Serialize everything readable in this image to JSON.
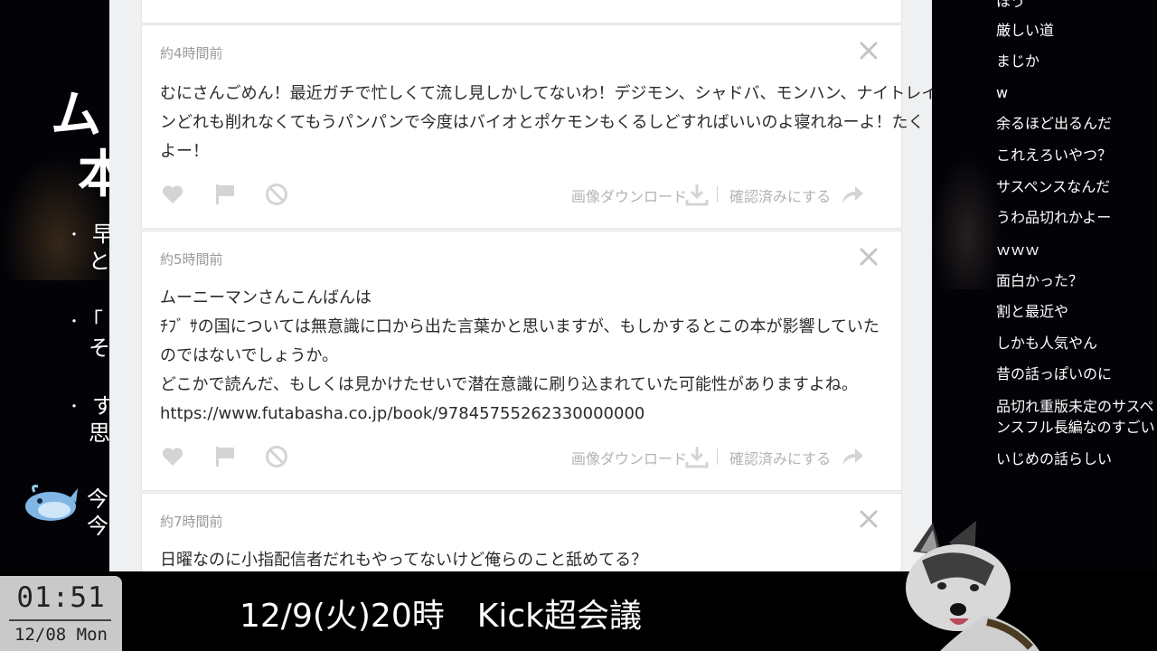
{
  "background": {
    "title_line1": "ム",
    "title_line2": "本",
    "bullets": [
      {
        "marker": "・",
        "line1": "早",
        "line2": "と"
      },
      {
        "marker": "・",
        "line1": "「",
        "line2": "そ"
      },
      {
        "marker": "・",
        "line1": "す",
        "line2": "思"
      }
    ],
    "blob_lines": [
      "今",
      "今"
    ]
  },
  "messages": [
    {
      "time": "約4時間前",
      "lines": [
        "むにさんごめん！最近ガチで忙しくて流し見しかしてないわ！デジモン、シャドバ、モンハン、ナイトレイ",
        "ンどれも削れなくてもうパンパンで今度はバイオとポケモンもくるしどすればいいのよ寝れねーよ！たく",
        "よー！"
      ],
      "download_label": "画像ダウンロード",
      "confirm_label": "確認済みにする"
    },
    {
      "time": "約5時間前",
      "lines": [
        "ムーニーマンさんこんばんは",
        "ﾁﾌﾞ ｻの国については無意識に口から出た言葉かと思いますが、もしかするとこの本が影響していた",
        "のではないでしょうか。",
        "どこかで読んだ、もしくは見かけたせいで潜在意識に刷り込まれていた可能性がありますよね。",
        "https://www.futabasha.co.jp/book/97845755262330000000"
      ],
      "download_label": "画像ダウンロード",
      "confirm_label": "確認済みにする"
    },
    {
      "time": "約7時間前",
      "lines": [
        "日曜なのに小指配信者だれもやってないけど俺らのこと舐めてる？"
      ]
    }
  ],
  "chat": [
    "ほう",
    "厳しい道",
    "まじか",
    "w",
    "余るほど出るんだ",
    "これえろいやつ？",
    "サスペンスなんだ",
    "うわ品切れかよー",
    "ｗｗｗ",
    "面白かった？",
    "割と最近や",
    "しかも人気やん",
    "昔の話っぽいのに",
    "品切れ重版未定のサスペ",
    "ンスフル長編なのすごい",
    "いじめの話らしい"
  ],
  "clock": {
    "time": "01:51",
    "date": "12/08 Mon"
  },
  "ticker": "12/9(火)20時　Kick超会議",
  "icons": {
    "close": "close-icon",
    "like": "heart-icon",
    "flag": "flag-icon",
    "block": "ban-icon",
    "download": "download-icon",
    "confirm": "share-arrow-icon"
  },
  "colors": {
    "panel_bg": "#eef0f2",
    "card_bg": "#ffffff",
    "icon_gray": "#d4d4d4",
    "clock_bg": "#c9c9c9"
  }
}
